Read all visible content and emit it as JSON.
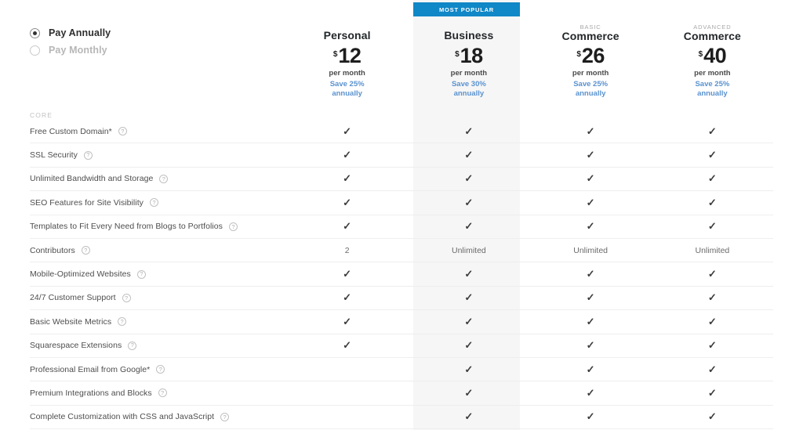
{
  "billing": {
    "options": [
      {
        "label": "Pay Annually",
        "selected": true
      },
      {
        "label": "Pay Monthly",
        "selected": false
      }
    ]
  },
  "banner": {
    "label": "MOST POPULAR",
    "color": "#1087c6",
    "applies_to": "Business"
  },
  "colors": {
    "accent_blue": "#1087c6",
    "link_blue": "#5a92cf",
    "highlight_band": "#f6f6f6",
    "divider": "#eeeeee"
  },
  "plans": [
    {
      "eyebrow": "",
      "name": "Personal",
      "currency": "$",
      "amount": "12",
      "period": "per month",
      "save_line1": "Save 25%",
      "save_line2": "annually",
      "highlighted": false
    },
    {
      "eyebrow": "",
      "name": "Business",
      "currency": "$",
      "amount": "18",
      "period": "per month",
      "save_line1": "Save 30%",
      "save_line2": "annually",
      "highlighted": true
    },
    {
      "eyebrow": "BASIC",
      "name": "Commerce",
      "currency": "$",
      "amount": "26",
      "period": "per month",
      "save_line1": "Save 25%",
      "save_line2": "annually",
      "highlighted": false
    },
    {
      "eyebrow": "ADVANCED",
      "name": "Commerce",
      "currency": "$",
      "amount": "40",
      "period": "per month",
      "save_line1": "Save 25%",
      "save_line2": "annually",
      "highlighted": false
    }
  ],
  "section": {
    "label": "CORE"
  },
  "help_icon_glyph": "?",
  "check_glyph": "✓",
  "features": [
    {
      "label": "Free Custom Domain*",
      "help": true,
      "values": [
        "check",
        "check",
        "check",
        "check"
      ]
    },
    {
      "label": "SSL Security",
      "help": true,
      "values": [
        "check",
        "check",
        "check",
        "check"
      ]
    },
    {
      "label": "Unlimited Bandwidth and Storage",
      "help": true,
      "values": [
        "check",
        "check",
        "check",
        "check"
      ]
    },
    {
      "label": "SEO Features for Site Visibility",
      "help": true,
      "values": [
        "check",
        "check",
        "check",
        "check"
      ]
    },
    {
      "label": "Templates to Fit Every Need from Blogs to Portfolios",
      "help": true,
      "values": [
        "check",
        "check",
        "check",
        "check"
      ]
    },
    {
      "label": "Contributors",
      "help": true,
      "values": [
        "2",
        "Unlimited",
        "Unlimited",
        "Unlimited"
      ]
    },
    {
      "label": "Mobile-Optimized Websites",
      "help": true,
      "values": [
        "check",
        "check",
        "check",
        "check"
      ]
    },
    {
      "label": "24/7 Customer Support",
      "help": true,
      "values": [
        "check",
        "check",
        "check",
        "check"
      ]
    },
    {
      "label": "Basic Website Metrics",
      "help": true,
      "values": [
        "check",
        "check",
        "check",
        "check"
      ]
    },
    {
      "label": "Squarespace Extensions",
      "help": true,
      "values": [
        "check",
        "check",
        "check",
        "check"
      ]
    },
    {
      "label": "Professional Email from Google*",
      "help": true,
      "values": [
        "",
        "check",
        "check",
        "check"
      ]
    },
    {
      "label": "Premium Integrations and Blocks",
      "help": true,
      "values": [
        "",
        "check",
        "check",
        "check"
      ]
    },
    {
      "label": "Complete Customization with CSS and JavaScript",
      "help": true,
      "values": [
        "",
        "check",
        "check",
        "check"
      ]
    }
  ]
}
